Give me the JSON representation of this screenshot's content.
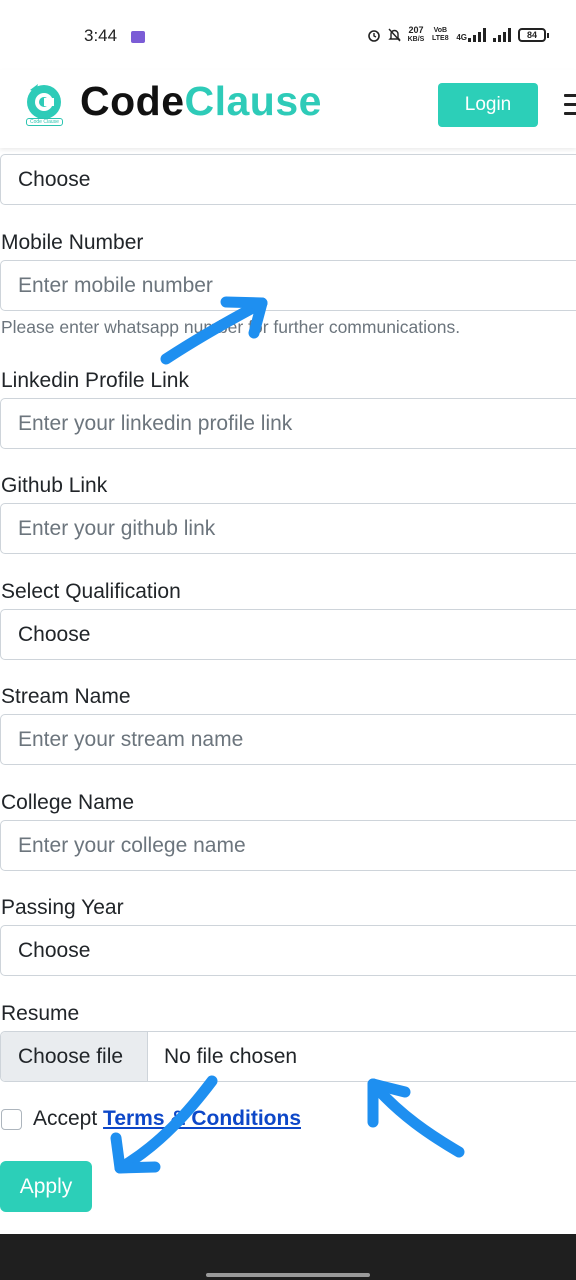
{
  "status_bar": {
    "time": "3:44",
    "net_speed_value": "207",
    "net_speed_unit": "KB/S",
    "volte": "VoB LTE8",
    "network": "4G",
    "battery": "84"
  },
  "header": {
    "brand_part1": "Code",
    "brand_part2": "Clause",
    "logo_caption": "Code Clause",
    "login_label": "Login"
  },
  "form": {
    "field1_select": "Choose",
    "mobile_label": "Mobile Number",
    "mobile_placeholder": "Enter mobile number",
    "mobile_help": "Please enter whatsapp number for further communications.",
    "linkedin_label": "Linkedin Profile Link",
    "linkedin_placeholder": "Enter your linkedin profile link",
    "github_label": "Github Link",
    "github_placeholder": "Enter your github link",
    "qualification_label": "Select Qualification",
    "qualification_select": "Choose",
    "stream_label": "Stream Name",
    "stream_placeholder": "Enter your stream name",
    "college_label": "College Name",
    "college_placeholder": "Enter your college name",
    "year_label": "Passing Year",
    "year_select": "Choose",
    "resume_label": "Resume",
    "file_button": "Choose file",
    "file_status": "No file chosen",
    "accept_text": "Accept",
    "terms_link": "Terms & Conditions",
    "apply_label": "Apply"
  },
  "colors": {
    "accent": "#2ccfb8",
    "annotation_arrow": "#1e8ff0",
    "link": "#0d47c8"
  }
}
